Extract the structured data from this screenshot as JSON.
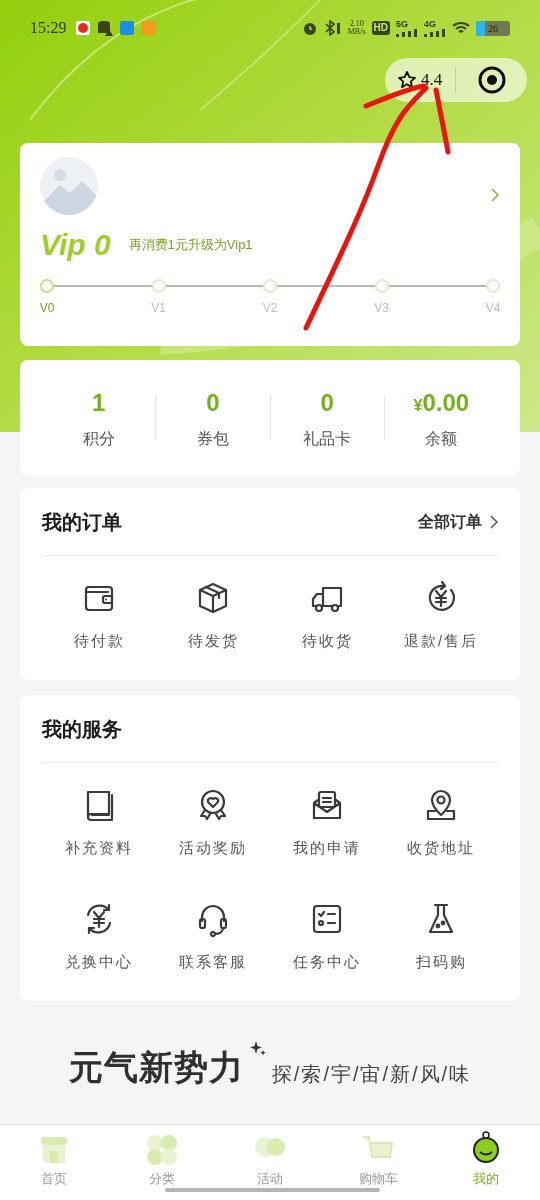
{
  "status_bar": {
    "time": "15:29",
    "speed": "2.10",
    "speed_unit": "MB/s",
    "hd": "HD",
    "sim1": "5G",
    "sim2": "4G",
    "battery": "26"
  },
  "capsule": {
    "rating": "4.4"
  },
  "member_card": {
    "level": "Vip 0",
    "upgrade_hint": "再消费1元升级为Vip1",
    "steps": [
      {
        "label": "V0",
        "selected": true
      },
      {
        "label": "V1",
        "selected": false
      },
      {
        "label": "V2",
        "selected": false
      },
      {
        "label": "V3",
        "selected": false
      },
      {
        "label": "V4",
        "selected": false
      }
    ]
  },
  "assets": [
    {
      "value": "1",
      "label": "积分"
    },
    {
      "value": "0",
      "label": "券包"
    },
    {
      "value": "0",
      "label": "礼品卡"
    },
    {
      "prefix": "¥",
      "value": "0.00",
      "label": "余额"
    }
  ],
  "orders": {
    "title": "我的订单",
    "all_link": "全部订单",
    "items": [
      {
        "kind": "wallet",
        "label": "待付款"
      },
      {
        "kind": "box",
        "label": "待发货"
      },
      {
        "kind": "truck",
        "label": "待收货"
      },
      {
        "kind": "refund",
        "label": "退款/售后"
      }
    ]
  },
  "services": {
    "title": "我的服务",
    "items": [
      {
        "kind": "book",
        "label": "补充资料"
      },
      {
        "kind": "badge",
        "label": "活动奖励"
      },
      {
        "kind": "mail",
        "label": "我的申请"
      },
      {
        "kind": "pin",
        "label": "收货地址"
      },
      {
        "kind": "exchange",
        "label": "兑换中心"
      },
      {
        "kind": "headset",
        "label": "联系客服"
      },
      {
        "kind": "checklist",
        "label": "任务中心"
      },
      {
        "kind": "flask",
        "label": "扫码购"
      }
    ]
  },
  "banner": {
    "title": "元气新势力",
    "slogan": "探/索/宇/宙/新/风/味"
  },
  "tab_bar": [
    {
      "kind": "home",
      "label": "首页",
      "selected": false
    },
    {
      "kind": "category",
      "label": "分类",
      "selected": false
    },
    {
      "kind": "event",
      "label": "活动",
      "selected": false
    },
    {
      "kind": "cart",
      "label": "购物车",
      "selected": false
    },
    {
      "kind": "me",
      "label": "我的",
      "selected": true
    }
  ]
}
